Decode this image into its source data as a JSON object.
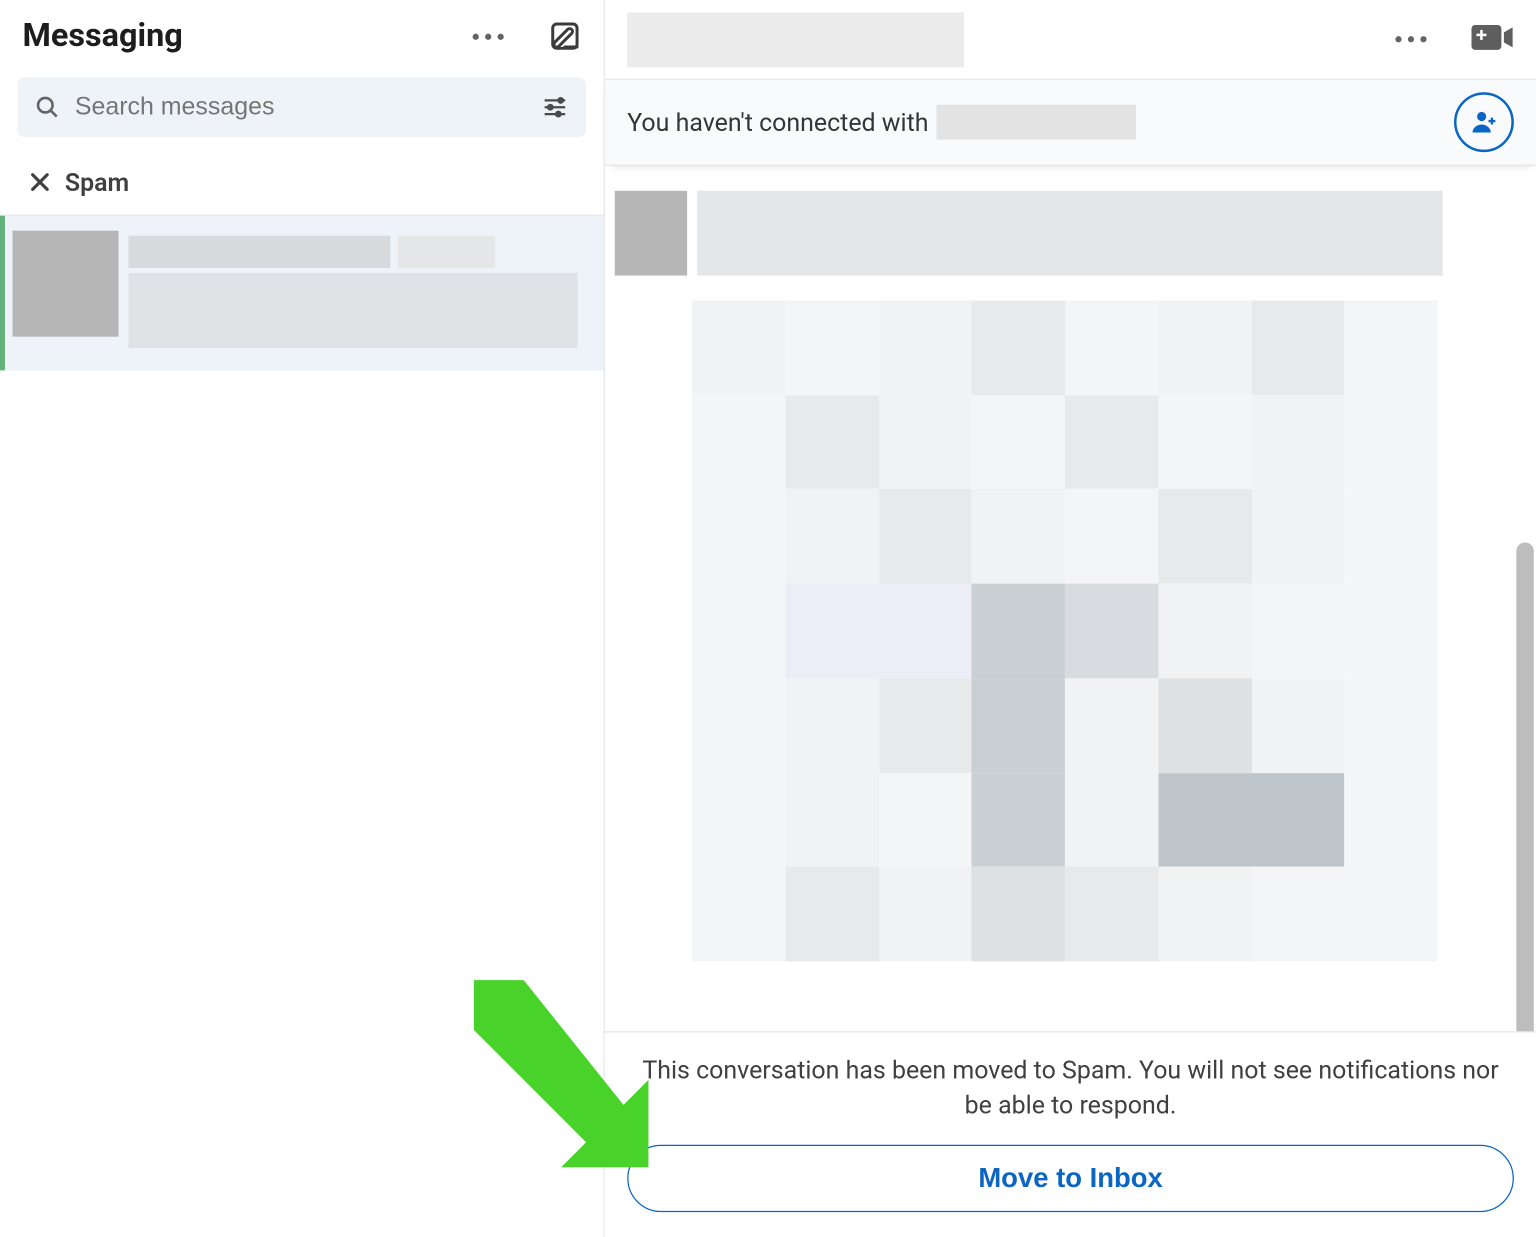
{
  "header": {
    "title": "Messaging"
  },
  "search": {
    "placeholder": "Search messages"
  },
  "folder": {
    "label": "Spam"
  },
  "connect": {
    "prefix": "You haven't connected with"
  },
  "spam_notice": {
    "text": "This conversation has been moved to Spam. You will not see notifications nor be able to respond.",
    "button_label": "Move to Inbox"
  }
}
